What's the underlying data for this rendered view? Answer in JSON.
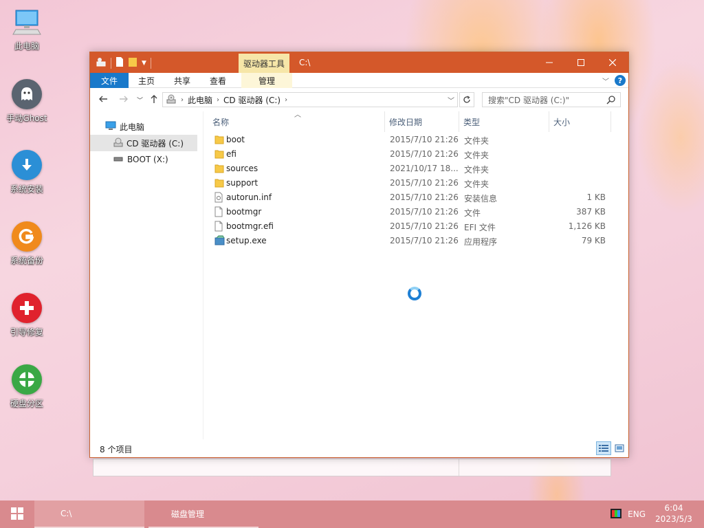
{
  "desktop": {
    "icons": [
      {
        "label": "此电脑",
        "icon": "computer-icon"
      },
      {
        "label": "手动Ghost",
        "icon": "ghost-icon"
      },
      {
        "label": "系统安装",
        "icon": "download-arrow-icon"
      },
      {
        "label": "系统备份",
        "icon": "g-backup-icon"
      },
      {
        "label": "引导修复",
        "icon": "red-plus-icon"
      },
      {
        "label": "硬盘分区",
        "icon": "partition-pie-icon"
      }
    ]
  },
  "window": {
    "title": "C:\\",
    "context_tab": "驱动器工具",
    "ribbon_tabs": {
      "file": "文件",
      "home": "主页",
      "share": "共享",
      "view": "查看",
      "manage": "管理"
    },
    "address": {
      "root": "此电脑",
      "drive": "CD 驱动器 (C:)"
    },
    "search_placeholder": "搜索\"CD 驱动器 (C:)\"",
    "nav": {
      "this_pc": "此电脑",
      "cd_drive": "CD 驱动器 (C:)",
      "boot_drive": "BOOT (X:)"
    },
    "columns": {
      "name": "名称",
      "date": "修改日期",
      "type": "类型",
      "size": "大小"
    },
    "files": [
      {
        "name": "boot",
        "date": "2015/7/10 21:26",
        "type": "文件夹",
        "size": "",
        "icon": "folder-icon"
      },
      {
        "name": "efi",
        "date": "2015/7/10 21:26",
        "type": "文件夹",
        "size": "",
        "icon": "folder-icon"
      },
      {
        "name": "sources",
        "date": "2021/10/17 18...",
        "type": "文件夹",
        "size": "",
        "icon": "folder-icon"
      },
      {
        "name": "support",
        "date": "2015/7/10 21:26",
        "type": "文件夹",
        "size": "",
        "icon": "folder-icon"
      },
      {
        "name": "autorun.inf",
        "date": "2015/7/10 21:26",
        "type": "安装信息",
        "size": "1 KB",
        "icon": "settings-file-icon"
      },
      {
        "name": "bootmgr",
        "date": "2015/7/10 21:26",
        "type": "文件",
        "size": "387 KB",
        "icon": "file-icon"
      },
      {
        "name": "bootmgr.efi",
        "date": "2015/7/10 21:26",
        "type": "EFI 文件",
        "size": "1,126 KB",
        "icon": "file-icon"
      },
      {
        "name": "setup.exe",
        "date": "2015/7/10 21:26",
        "type": "应用程序",
        "size": "79 KB",
        "icon": "setup-exe-icon"
      }
    ],
    "status_count": "8 个项目"
  },
  "taskbar": {
    "tasks": [
      {
        "label": "C:\\"
      },
      {
        "label": "磁盘管理"
      }
    ],
    "lang": "ENG",
    "time": "6:04",
    "date": "2023/5/3"
  },
  "colors": {
    "titlebar": "#d4582a",
    "file_tab": "#1979ca",
    "taskbar": "#d98a8e"
  }
}
